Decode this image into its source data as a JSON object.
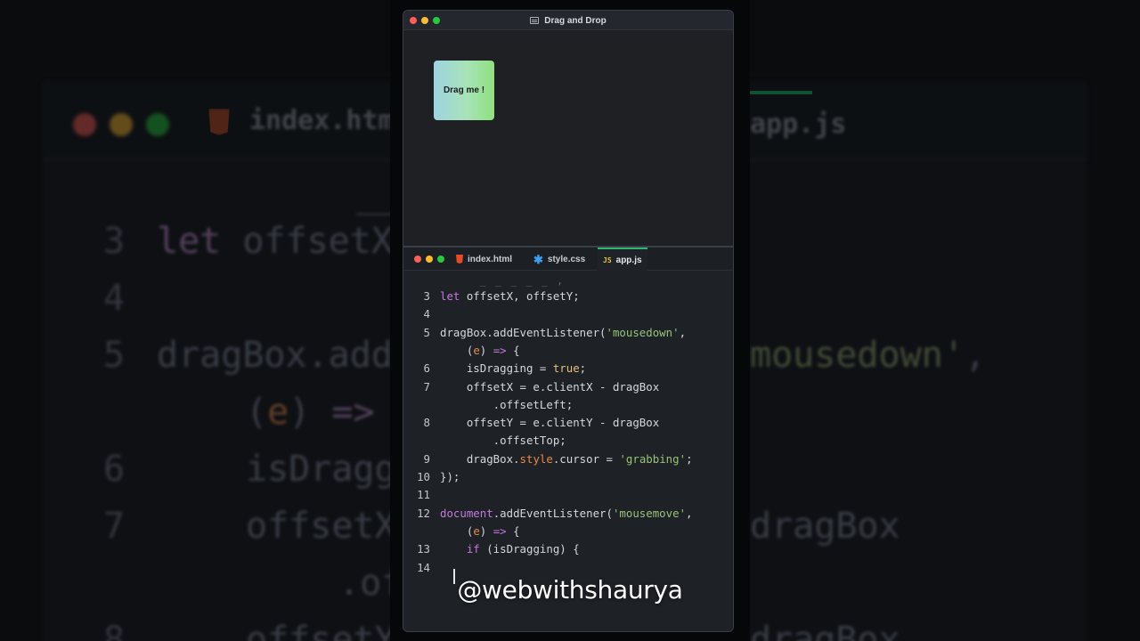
{
  "window": {
    "title": "Drag and Drop"
  },
  "preview": {
    "drag_box_label": "Drag me !"
  },
  "tabs": [
    {
      "label": "index.html",
      "icon": "html5-icon",
      "active": false
    },
    {
      "label": "style.css",
      "icon": "css-icon",
      "active": false
    },
    {
      "label": "app.js",
      "icon": "js-icon",
      "active": true
    }
  ],
  "editor": {
    "lines": [
      {
        "num": "3",
        "text": "let offsetX, offsetY;"
      },
      {
        "num": "4",
        "text": ""
      },
      {
        "num": "5",
        "text": "dragBox.addEventListener('mousedown',",
        "cont": "    (e) => {"
      },
      {
        "num": "6",
        "text": "    isDragging = true;"
      },
      {
        "num": "7",
        "text": "    offsetX = e.clientX - dragBox",
        "cont": "        .offsetLeft;"
      },
      {
        "num": "8",
        "text": "    offsetY = e.clientY - dragBox",
        "cont": "        .offsetTop;"
      },
      {
        "num": "9",
        "text": "    dragBox.style.cursor = 'grabbing';"
      },
      {
        "num": "10",
        "text": "});"
      },
      {
        "num": "11",
        "text": ""
      },
      {
        "num": "12",
        "text": "document.addEventListener('mousemove',",
        "cont": "    (e) => {"
      },
      {
        "num": "13",
        "text": "    if (isDragging) {"
      },
      {
        "num": "14",
        "text": ""
      }
    ]
  },
  "background": {
    "tab_html": "index.html",
    "tab_js": "app.js",
    "code": [
      {
        "num": "3",
        "text": "let offsetX"
      },
      {
        "num": "4",
        "text": ""
      },
      {
        "num": "5",
        "text": "dragBox.add",
        "tail": "mousedown',"
      },
      {
        "num": "",
        "text": "(e) =>"
      },
      {
        "num": "6",
        "text": "isDragg"
      },
      {
        "num": "7",
        "text": "offsetX",
        "tail": "dragBox"
      },
      {
        "num": "",
        "text": ".of"
      },
      {
        "num": "8",
        "text": "offsetY",
        "tail": "dragBox"
      }
    ]
  },
  "watermark": "@webwithshaurya",
  "colors": {
    "traffic_red": "#ff5f57",
    "traffic_yellow": "#febc2e",
    "traffic_green": "#28c840",
    "active_tab_accent": "#2cb870"
  }
}
